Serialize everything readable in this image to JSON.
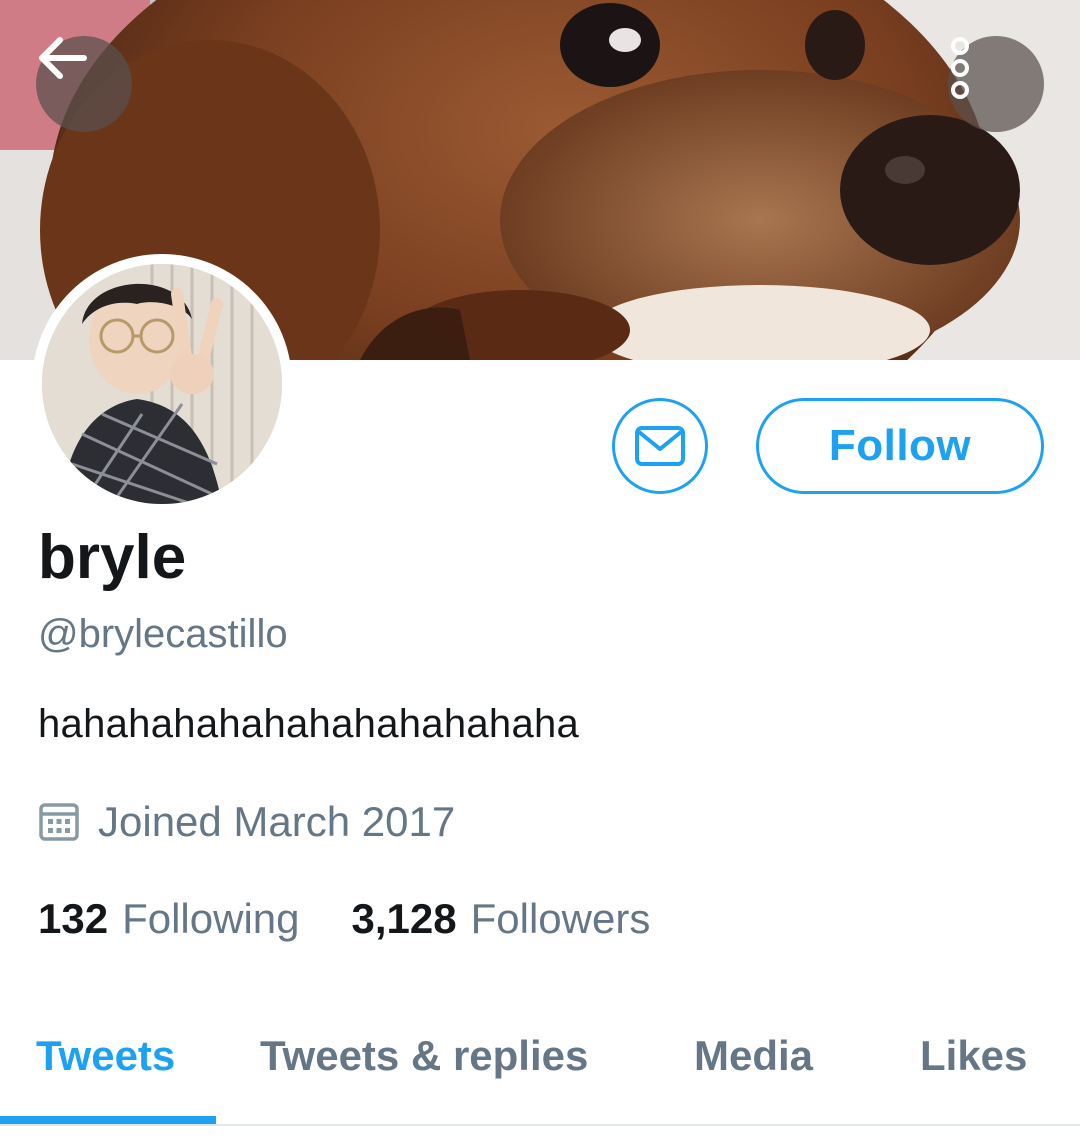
{
  "header": {
    "back_icon": "arrow-left-icon",
    "more_icon": "more-vertical-icon"
  },
  "profile": {
    "display_name": "bryle",
    "handle": "@brylecastillo",
    "bio": "hahahahahahahahahahahaha",
    "joined": "Joined March 2017",
    "joined_icon": "calendar-icon"
  },
  "actions": {
    "message_icon": "envelope-icon",
    "follow_label": "Follow"
  },
  "stats": {
    "following_count": "132",
    "following_label": "Following",
    "followers_count": "3,128",
    "followers_label": "Followers"
  },
  "tabs": [
    {
      "label": "Tweets",
      "active": true
    },
    {
      "label": "Tweets & replies",
      "active": false
    },
    {
      "label": "Media",
      "active": false
    },
    {
      "label": "Likes",
      "active": false
    }
  ],
  "colors": {
    "accent": "#1da1f2",
    "secondary_text": "#657786",
    "primary_text": "#14171a"
  }
}
